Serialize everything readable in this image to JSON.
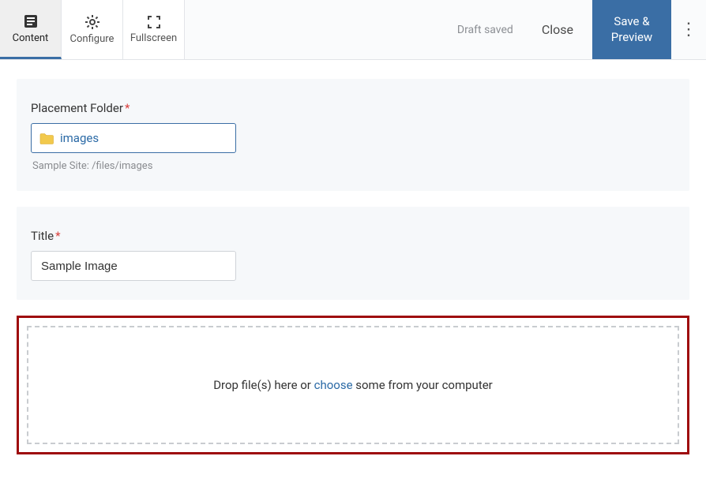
{
  "toolbar": {
    "tabs": {
      "content": "Content",
      "configure": "Configure",
      "fullscreen": "Fullscreen"
    },
    "draft_status": "Draft saved",
    "close_label": "Close",
    "save_label": "Save & Preview"
  },
  "placement": {
    "label": "Placement Folder",
    "value": "images",
    "helper": "Sample Site: /files/images"
  },
  "title_field": {
    "label": "Title",
    "value": "Sample Image"
  },
  "upload": {
    "prefix": "Drop file(s) here or ",
    "link": "choose",
    "suffix": " some from your computer"
  }
}
